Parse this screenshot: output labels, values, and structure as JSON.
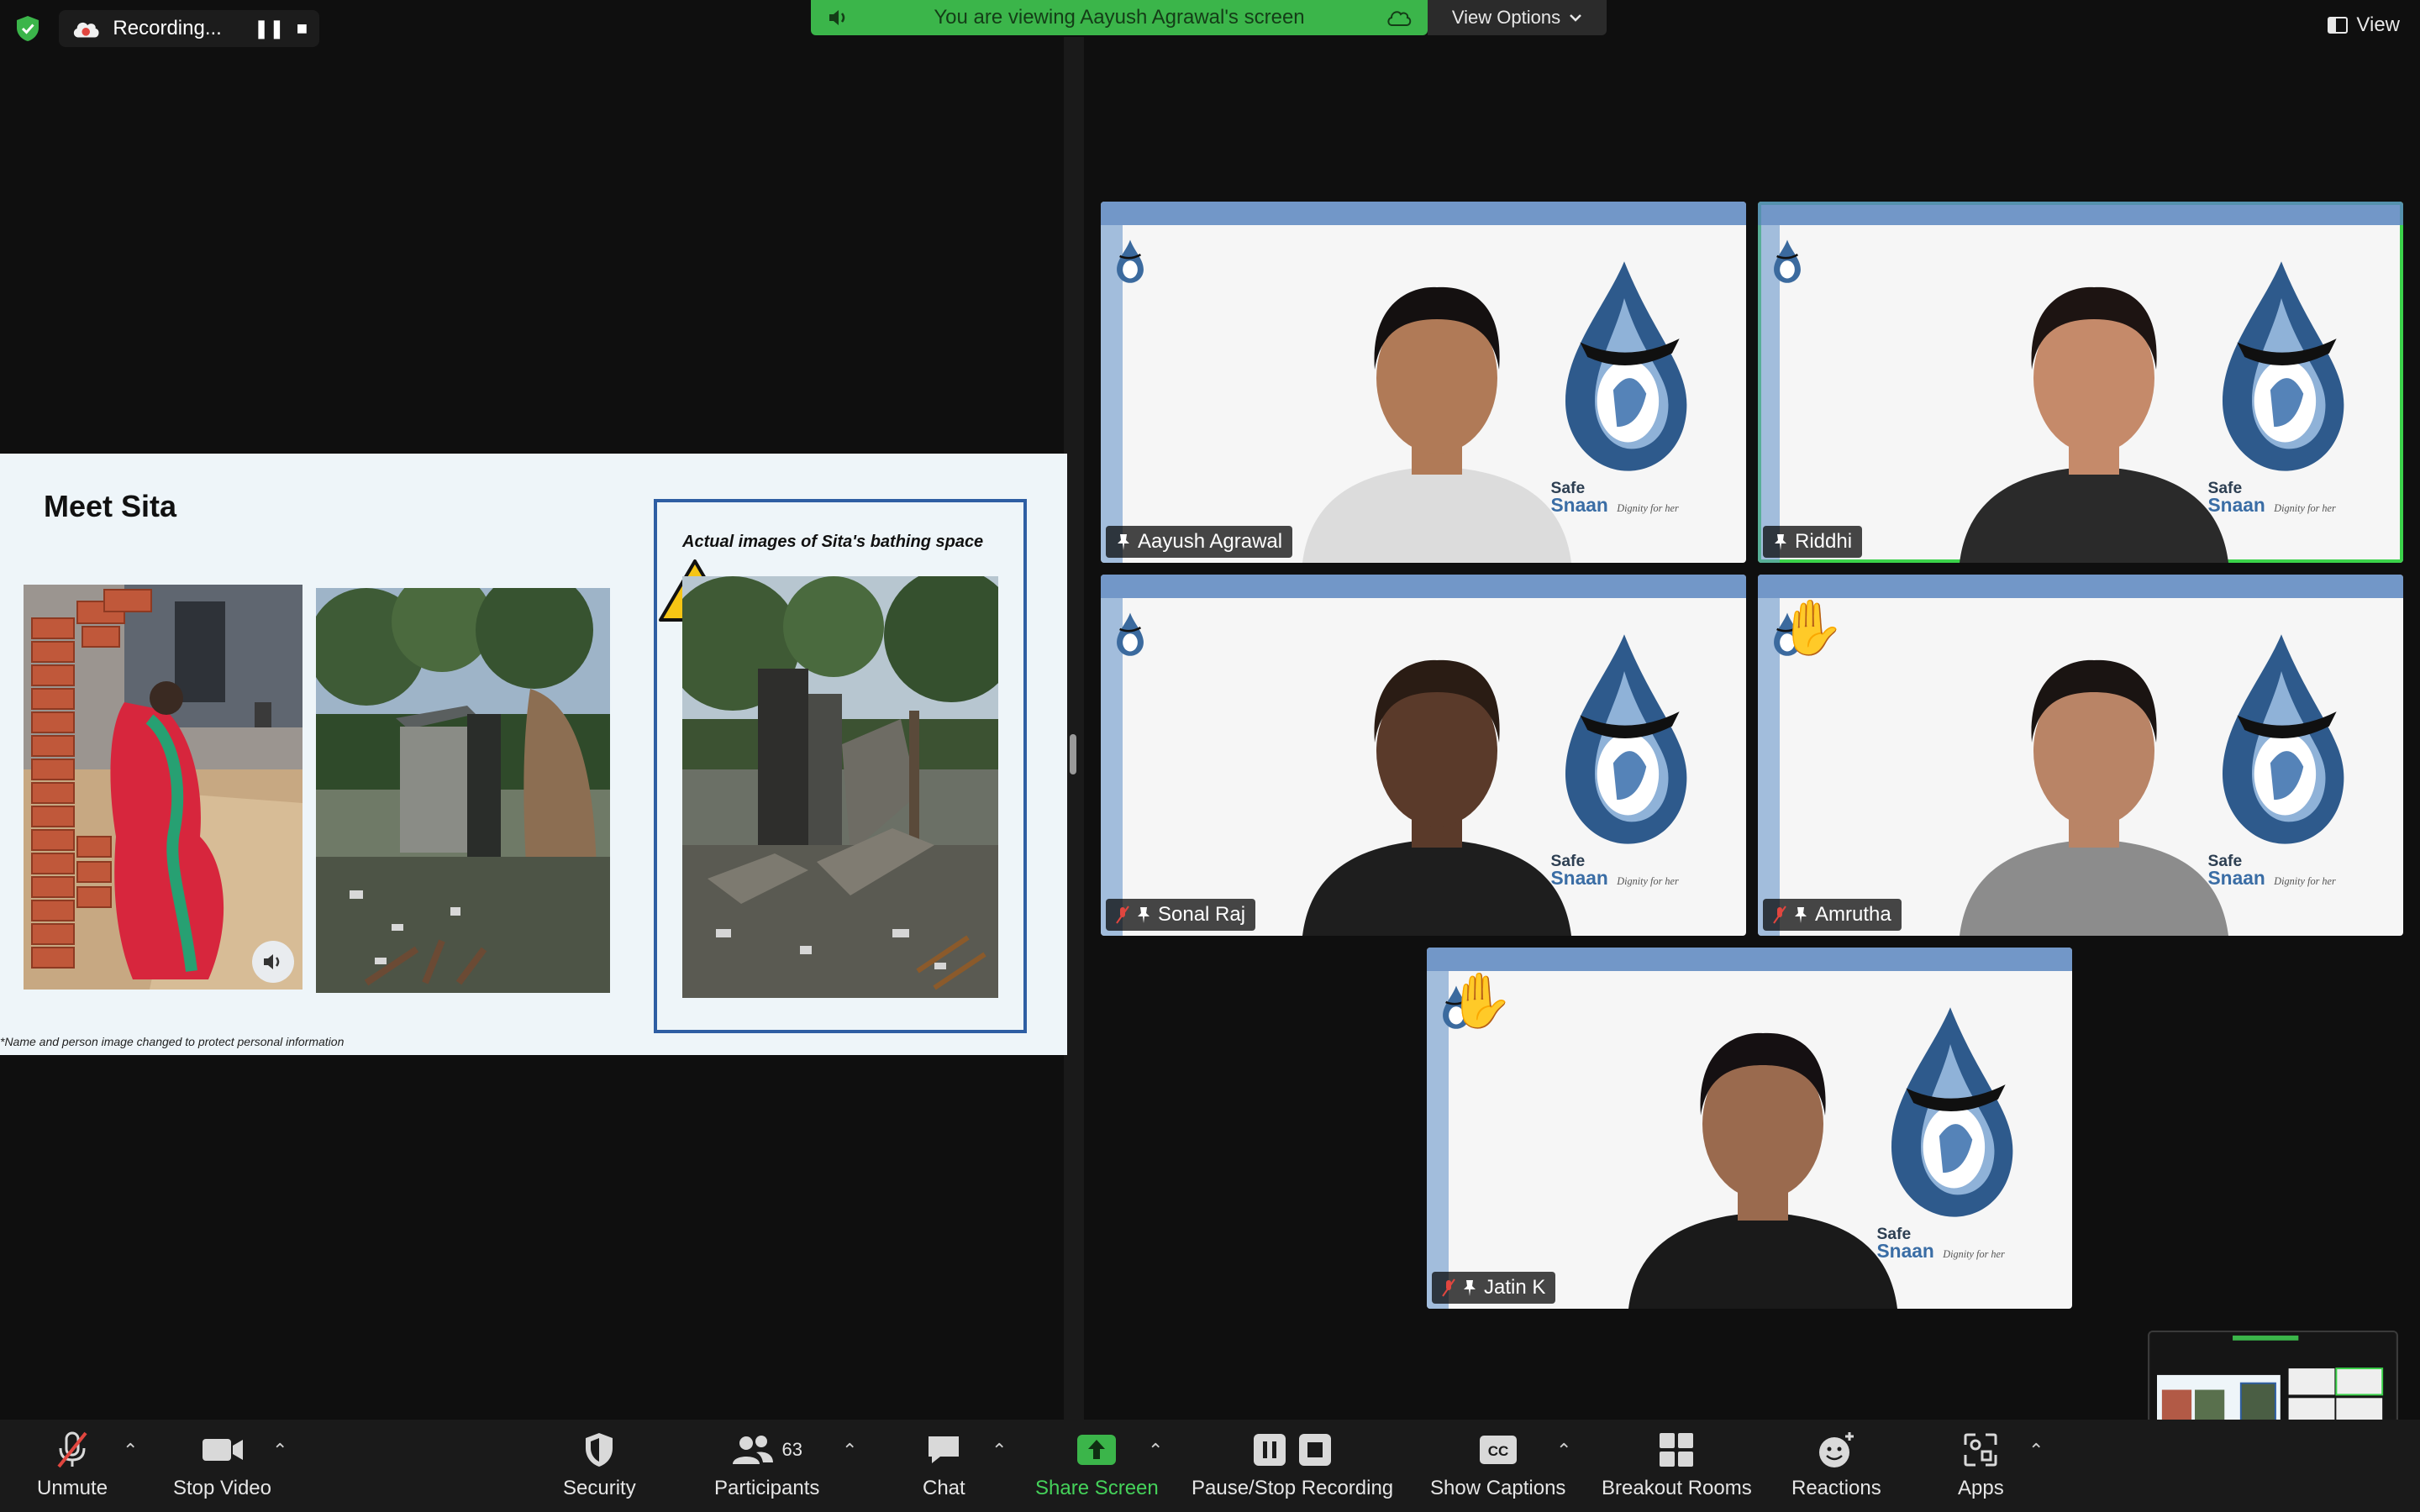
{
  "top": {
    "recording_label": "Recording...",
    "banner_text": "You are viewing Aayush Agrawal's screen",
    "view_options_label": "View Options",
    "view_label": "View"
  },
  "slide": {
    "title": "Meet Sita",
    "caption": "Actual images of Sita's bathing space",
    "footnote": "*Name and person image changed to protect personal information"
  },
  "participants": [
    {
      "name": "Aayush Agrawal",
      "muted": false,
      "hand_raised": false,
      "active_speaker": false
    },
    {
      "name": "Riddhi",
      "muted": false,
      "hand_raised": false,
      "active_speaker": true
    },
    {
      "name": "Sonal Raj",
      "muted": true,
      "hand_raised": false,
      "active_speaker": false
    },
    {
      "name": "Amrutha",
      "muted": true,
      "hand_raised": true,
      "active_speaker": false
    },
    {
      "name": "Jatin K",
      "muted": true,
      "hand_raised": true,
      "active_speaker": false
    }
  ],
  "logo_text": {
    "safe": "Safe",
    "snaan": "Snaan",
    "tagline": "Dignity for her"
  },
  "toolbar": {
    "unmute": "Unmute",
    "stop_video": "Stop Video",
    "security": "Security",
    "participants": "Participants",
    "participants_count": "63",
    "chat": "Chat",
    "share_screen": "Share Screen",
    "pause_stop_recording": "Pause/Stop Recording",
    "show_captions": "Show Captions",
    "breakout_rooms": "Breakout Rooms",
    "reactions": "Reactions",
    "apps": "Apps"
  },
  "colors": {
    "accent_green": "#3bb54a",
    "active_outline": "#3bd24a",
    "toolbar_bg": "#1a1a1a",
    "slide_frame": "#2e5ea3"
  },
  "icons": [
    "shield-check-icon",
    "cloud-record-icon",
    "pause-icon",
    "stop-icon",
    "speaker-icon",
    "cloud-icon",
    "chevron-down-icon",
    "view-icon",
    "microphone-off-icon",
    "video-camera-icon",
    "shield-icon",
    "participants-icon",
    "chat-icon",
    "share-screen-icon",
    "pause-stop-icon",
    "cc-icon",
    "breakout-rooms-icon",
    "reactions-icon",
    "apps-icon",
    "warning-icon",
    "raised-hand-icon",
    "pin-icon"
  ]
}
